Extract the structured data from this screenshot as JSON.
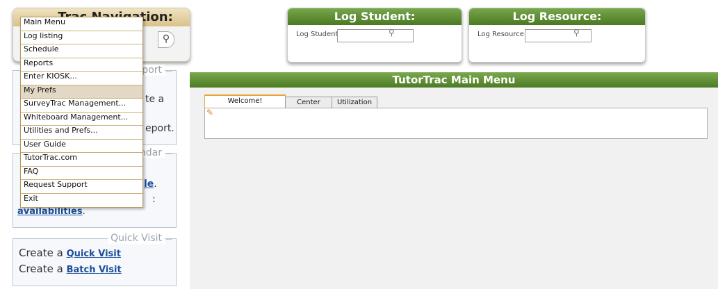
{
  "nav": {
    "title": "Trac Navigation:"
  },
  "menu": {
    "items": [
      {
        "label": "Main Menu"
      },
      {
        "label": "Log listing"
      },
      {
        "label": "Schedule"
      },
      {
        "label": "Reports"
      },
      {
        "label": "Enter KIOSK..."
      },
      {
        "label": "My Prefs",
        "highlighted": true
      },
      {
        "label": "SurveyTrac Management..."
      },
      {
        "label": "Whiteboard Management..."
      },
      {
        "label": "Utilities and Prefs..."
      },
      {
        "label": "User Guide"
      },
      {
        "label": "TutorTrac.com"
      },
      {
        "label": "FAQ"
      },
      {
        "label": "Request Support"
      },
      {
        "label": "Exit"
      }
    ]
  },
  "report_box": {
    "legend_fragment": "eport",
    "line1_fragment": "te a",
    "line2_fragment": "eport."
  },
  "calendar_box": {
    "legend_fragment": "ndar",
    "link_fragment": "le",
    "dot": ".",
    "colon_fragment": ":",
    "availabilities": "availabilities",
    "period": "."
  },
  "quick_visit": {
    "legend": "Quick Visit",
    "line1_prefix": "Create a",
    "line1_link": "Quick Visit",
    "line2_prefix": "Create a",
    "line2_link": "Batch Visit"
  },
  "log_student": {
    "title": "Log Student:",
    "label": "Log Student:"
  },
  "log_resource": {
    "title": "Log Resource:",
    "label": "Log Resource:"
  },
  "main": {
    "title": "TutorTrac Main Menu",
    "tabs": [
      {
        "label": "Welcome!",
        "active": true
      },
      {
        "label": "Center Status"
      },
      {
        "label": "Utilization"
      }
    ]
  },
  "icons": {
    "search": "magnifier-icon",
    "edit": "pencil-icon"
  }
}
